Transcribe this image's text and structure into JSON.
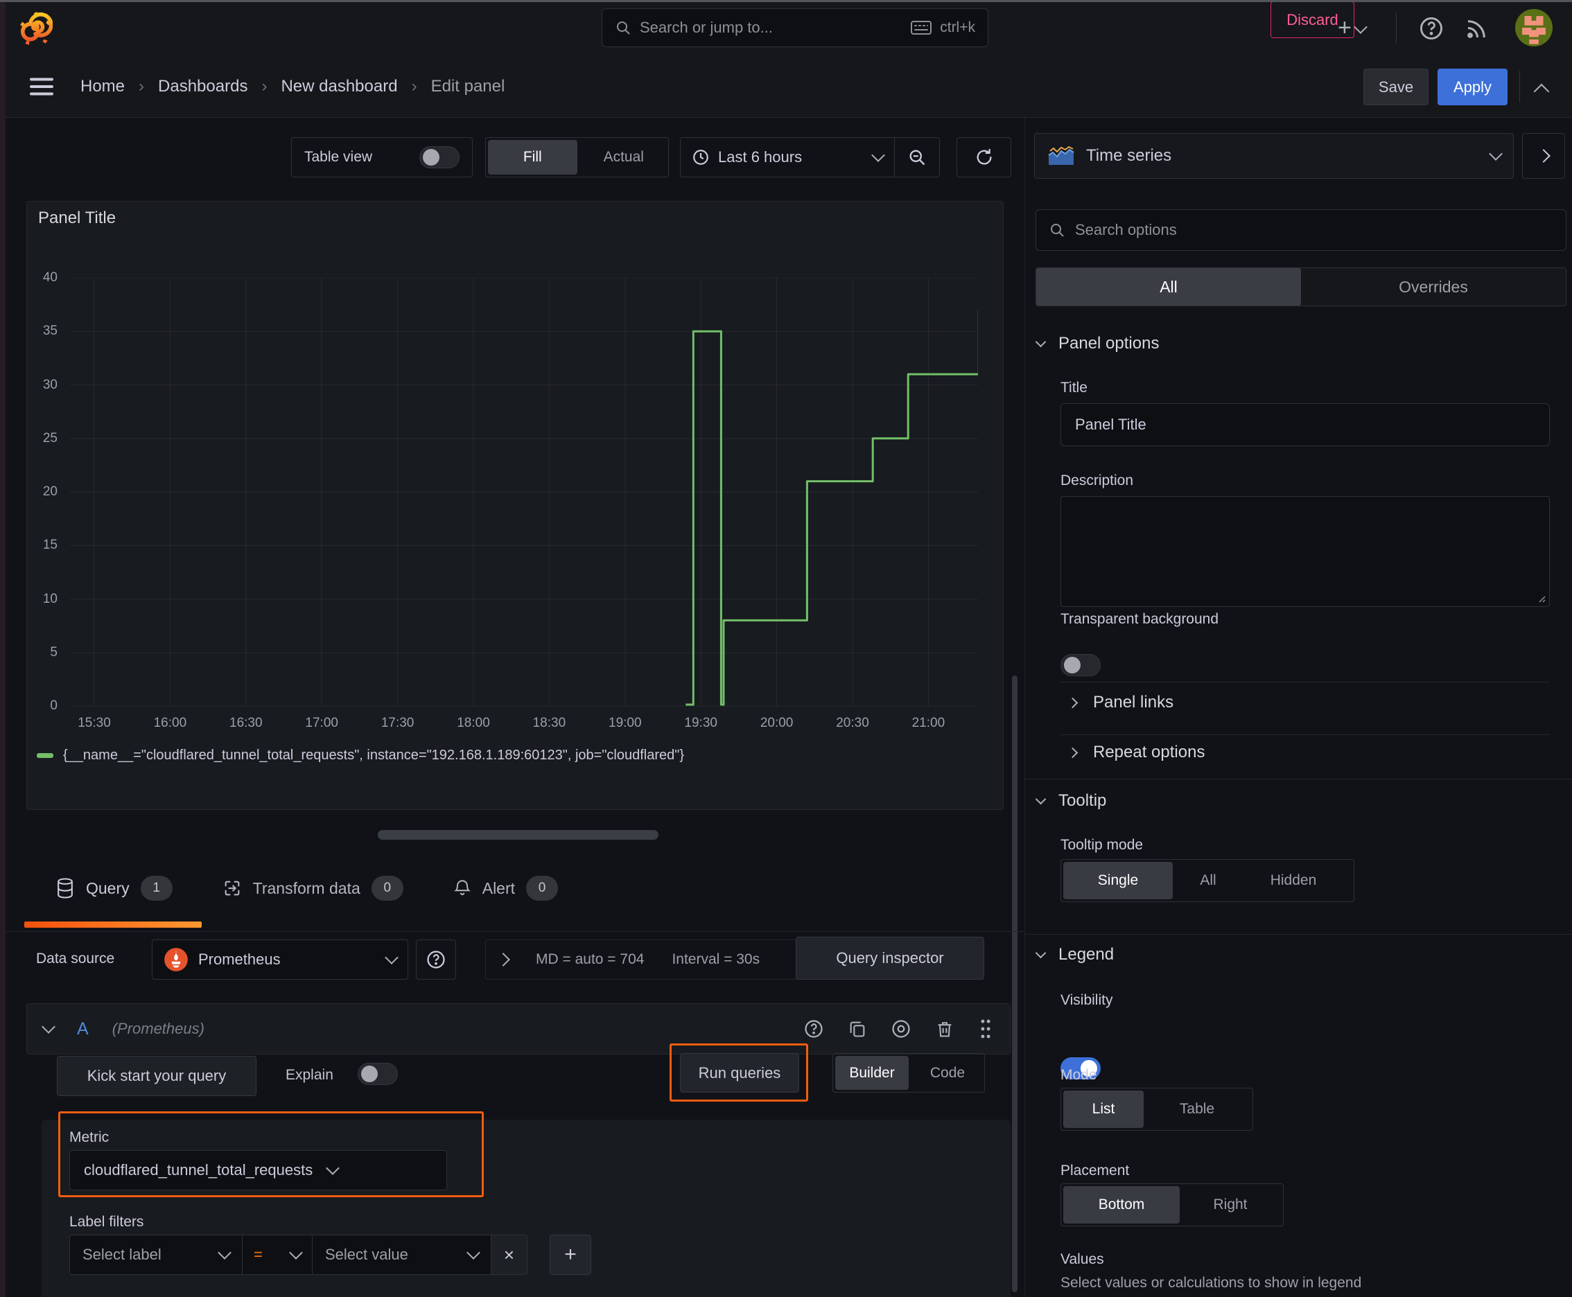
{
  "topbar": {
    "search_placeholder": "Search or jump to...",
    "shortcut": "ctrl+k"
  },
  "breadcrumb": {
    "items": [
      "Home",
      "Dashboards",
      "New dashboard",
      "Edit panel"
    ]
  },
  "actions": {
    "discard": "Discard",
    "save": "Save",
    "apply": "Apply"
  },
  "toolbar": {
    "table_view": "Table view",
    "fill": "Fill",
    "actual": "Actual",
    "time_range": "Last 6 hours"
  },
  "panel": {
    "title": "Panel Title"
  },
  "chart_data": {
    "type": "line",
    "title": "Panel Title",
    "x_ticks": [
      "15:30",
      "16:00",
      "16:30",
      "17:00",
      "17:30",
      "18:00",
      "18:30",
      "19:00",
      "19:30",
      "20:00",
      "20:30",
      "21:00"
    ],
    "y_ticks": [
      0,
      5,
      10,
      15,
      20,
      25,
      30,
      35,
      40
    ],
    "ylim": [
      0,
      40
    ],
    "grid": true,
    "legend_position": "bottom",
    "series": [
      {
        "name": "{__name__=\"cloudflared_tunnel_total_requests\", instance=\"192.168.1.189:60123\", job=\"cloudflared\"}",
        "color": "#73bf69",
        "step_points": [
          [
            "19:24",
            0
          ],
          [
            "19:27",
            35
          ],
          [
            "19:38",
            0
          ],
          [
            "19:39",
            8
          ],
          [
            "20:12",
            21
          ],
          [
            "20:38",
            25
          ],
          [
            "20:52",
            31
          ],
          [
            "21:20",
            37
          ]
        ]
      }
    ]
  },
  "tabs": {
    "query": "Query",
    "query_count": "1",
    "transform": "Transform data",
    "transform_count": "0",
    "alert": "Alert",
    "alert_count": "0"
  },
  "datasource": {
    "label": "Data source",
    "name": "Prometheus",
    "md": "MD = auto = 704",
    "interval": "Interval = 30s",
    "inspector": "Query inspector"
  },
  "query_row": {
    "letter": "A",
    "hint": "(Prometheus)"
  },
  "query_toolbar": {
    "kickstart": "Kick start your query",
    "explain": "Explain",
    "run": "Run queries",
    "builder": "Builder",
    "code": "Code"
  },
  "editor": {
    "metric_label": "Metric",
    "metric_value": "cloudflared_tunnel_total_requests",
    "label_filters": "Label filters",
    "select_label": "Select label",
    "operator": "=",
    "select_value": "Select value",
    "remove": "×",
    "add": "+"
  },
  "options": {
    "viz_name": "Time series",
    "search_placeholder": "Search options",
    "tab_all": "All",
    "tab_overrides": "Overrides",
    "panel_options": "Panel options",
    "title_label": "Title",
    "title_value": "Panel Title",
    "description_label": "Description",
    "transparent_label": "Transparent background",
    "panel_links": "Panel links",
    "repeat_options": "Repeat options",
    "tooltip": "Tooltip",
    "tooltip_mode": "Tooltip mode",
    "tooltip_single": "Single",
    "tooltip_all": "All",
    "tooltip_hidden": "Hidden",
    "legend": "Legend",
    "visibility": "Visibility",
    "mode": "Mode",
    "mode_list": "List",
    "mode_table": "Table",
    "placement": "Placement",
    "placement_bottom": "Bottom",
    "placement_right": "Right",
    "values": "Values",
    "values_desc": "Select values or calculations to show in legend"
  },
  "colors": {
    "accent_orange": "#ff780a",
    "highlight": "#f35d12",
    "series_green": "#73bf69",
    "apply_blue": "#3d71d9",
    "discard_pink": "#e0246e"
  }
}
